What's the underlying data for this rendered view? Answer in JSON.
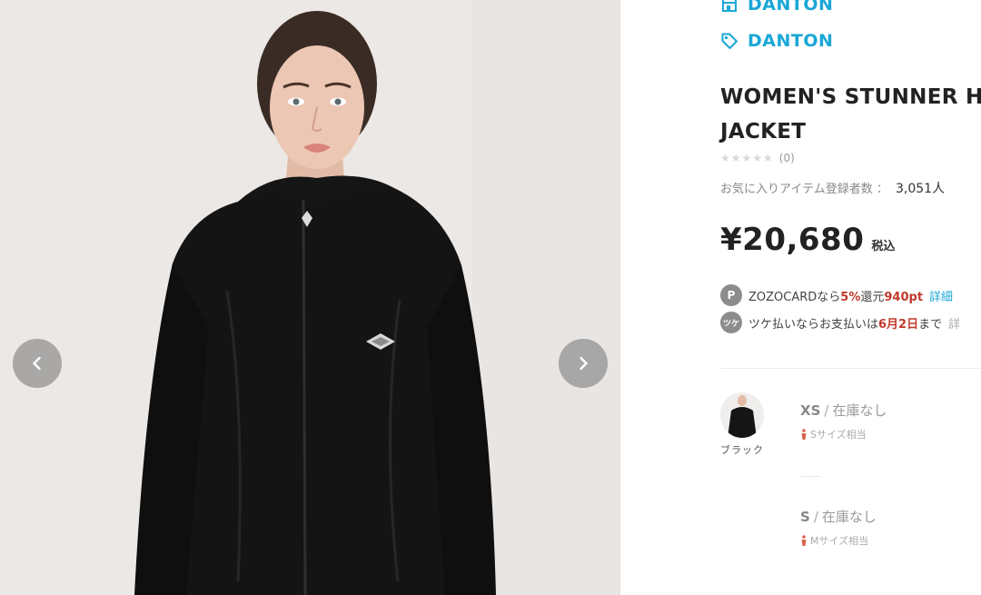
{
  "gallery": {
    "prev_icon": "chevron-left-icon",
    "next_icon": "chevron-right-icon"
  },
  "brand": {
    "shop_name": "DANTON",
    "tag_name": "DANTON",
    "color": "#1aa7d6"
  },
  "product": {
    "title_line1": "WOMEN'S STUNNER HOODED",
    "title_line2": "JACKET",
    "rating_stars": "★★★★★",
    "rating_count": "(0)",
    "favorites_label": "お気に入りアイテム登録者数 ：",
    "favorites_count": "3,051人",
    "price": "¥20,680",
    "tax_label": "税込"
  },
  "promos": {
    "zozocard": {
      "icon_letter": "P",
      "prefix": "ZOZOCARDなら",
      "rate": "5%",
      "middle": "還元",
      "points": "940pt",
      "link": "詳細"
    },
    "tsuke": {
      "icon_text": "ツケ",
      "prefix": "ツケ払いならお支払いは",
      "date": "6月2日",
      "suffix": "まで",
      "more": "詳"
    }
  },
  "variants": {
    "color_label": "ブラック",
    "sizes": [
      {
        "code": "XS",
        "sep": "/",
        "stock": "在庫なし",
        "note": "Sサイズ相当"
      },
      {
        "code": "S",
        "sep": "/",
        "stock": "在庫なし",
        "note": "Mサイズ相当"
      }
    ]
  }
}
